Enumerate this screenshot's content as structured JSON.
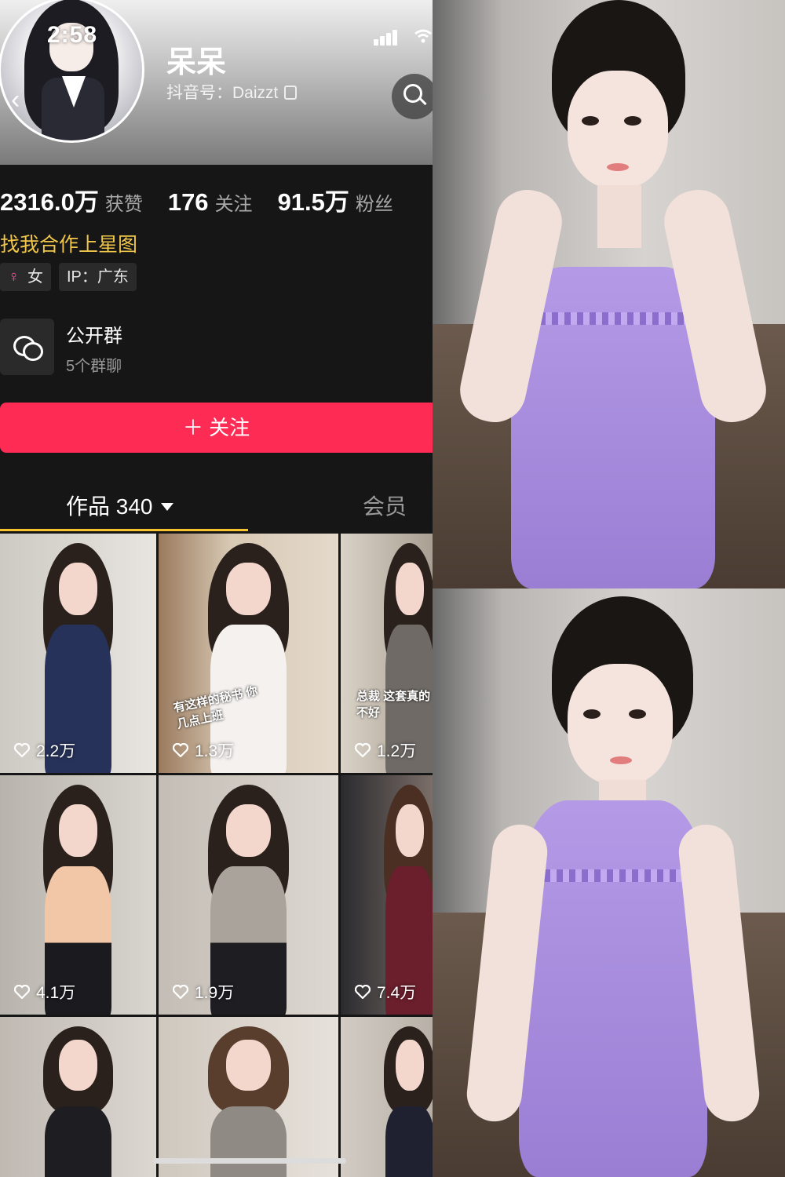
{
  "status_bar": {
    "time": "2:58"
  },
  "profile": {
    "name": "呆呆",
    "douyin_id": "抖音号：Daizzt",
    "stats": [
      {
        "value": "2316.0万",
        "label": "获赞"
      },
      {
        "value": "176",
        "label": "关注"
      },
      {
        "value": "91.5万",
        "label": "粉丝"
      }
    ],
    "bio": "找我合作上星图",
    "tags": [
      {
        "icon": "female-icon",
        "label": "女"
      },
      {
        "label": "IP：广东"
      }
    ],
    "group": {
      "title": "公开群",
      "subtitle": "5个群聊"
    },
    "follow_label": "＋ 关注"
  },
  "tabs": {
    "works": "作品 340",
    "member": "会员"
  },
  "videos": [
    {
      "likes": "2.2万",
      "caption": ""
    },
    {
      "likes": "1.3万",
      "caption": "有这样的秘书 你几点上班"
    },
    {
      "likes": "1.2万",
      "caption": "总裁 这套真的不好"
    },
    {
      "likes": "4.1万",
      "caption": ""
    },
    {
      "likes": "1.9万",
      "caption": ""
    },
    {
      "likes": "7.4万",
      "caption": ""
    },
    {
      "likes": "",
      "caption": ""
    },
    {
      "likes": "",
      "caption": ""
    },
    {
      "likes": "",
      "caption": ""
    }
  ],
  "colors": {
    "follow_button": "#fe2c55",
    "bio_text": "#f0c64a",
    "tab_underline": "#f7c430",
    "dress": "#a88ee0"
  }
}
